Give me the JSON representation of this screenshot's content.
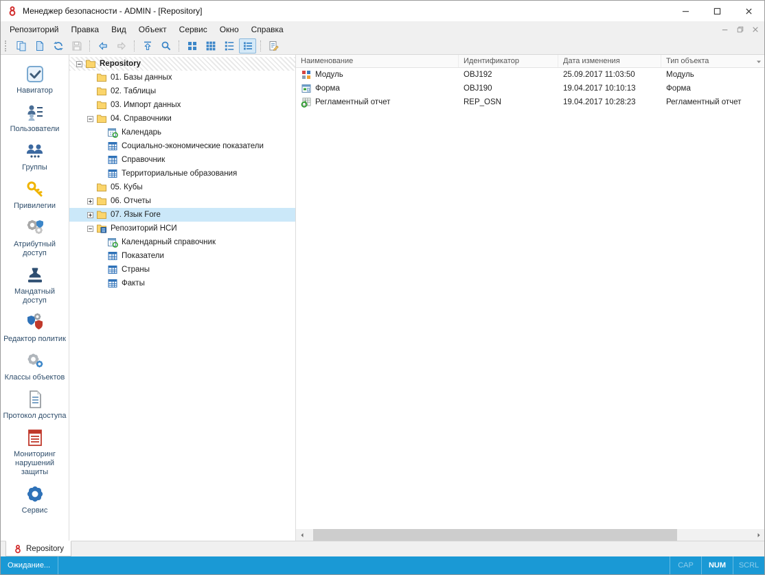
{
  "colors": {
    "statusbar_background": "#1a99d5",
    "tree_selection_background": "#cbe8f9",
    "toolbar_selected_background": "#d5e9f7",
    "accent_blue": "#2f72b8"
  },
  "window": {
    "title": "Менеджер безопасности - ADMIN - [Repository]",
    "app_icon": "app-logo-icon",
    "controls": [
      {
        "name": "minimize-button",
        "icon": "minimize-icon"
      },
      {
        "name": "maximize-button",
        "icon": "maximize-icon"
      },
      {
        "name": "close-button",
        "icon": "close-icon"
      }
    ]
  },
  "menubar": {
    "items": [
      {
        "name": "menu-repository",
        "label": "Репозиторий"
      },
      {
        "name": "menu-edit",
        "label": "Правка"
      },
      {
        "name": "menu-view",
        "label": "Вид"
      },
      {
        "name": "menu-object",
        "label": "Объект"
      },
      {
        "name": "menu-service",
        "label": "Сервис"
      },
      {
        "name": "menu-window",
        "label": "Окно"
      },
      {
        "name": "menu-help",
        "label": "Справка"
      }
    ],
    "mdi_controls": [
      {
        "name": "mdi-minimize-button",
        "icon": "mdi-minimize-icon"
      },
      {
        "name": "mdi-restore-button",
        "icon": "mdi-restore-icon"
      },
      {
        "name": "mdi-close-button",
        "icon": "mdi-close-icon"
      }
    ]
  },
  "toolbar": {
    "buttons": [
      {
        "name": "new-object-button",
        "icon": "new-page-icon"
      },
      {
        "name": "open-object-button",
        "icon": "page-icon"
      },
      {
        "name": "refresh-button",
        "icon": "refresh-icon"
      },
      {
        "name": "save-button",
        "icon": "save-icon",
        "disabled": true
      },
      {
        "separator": true
      },
      {
        "name": "back-button",
        "icon": "back-icon"
      },
      {
        "name": "forward-button",
        "icon": "forward-icon",
        "disabled": true
      },
      {
        "separator": true
      },
      {
        "name": "up-level-button",
        "icon": "up-level-icon"
      },
      {
        "name": "search-button",
        "icon": "search-icon"
      },
      {
        "separator": true
      },
      {
        "name": "view-large-icons-button",
        "icon": "view-large-icons-icon"
      },
      {
        "name": "view-small-icons-button",
        "icon": "view-small-icons-icon"
      },
      {
        "name": "view-list-button",
        "icon": "view-list-icon"
      },
      {
        "name": "view-details-button",
        "icon": "view-details-icon",
        "selected": true
      },
      {
        "separator": true
      },
      {
        "name": "properties-button",
        "icon": "properties-icon"
      }
    ]
  },
  "sidebar": {
    "items": [
      {
        "name": "sidebar-item-navigator",
        "label": "Навигатор",
        "icon": "navigator-icon",
        "selected": true
      },
      {
        "name": "sidebar-item-users",
        "label": "Пользователи",
        "icon": "users-icon"
      },
      {
        "name": "sidebar-item-groups",
        "label": "Группы",
        "icon": "groups-icon"
      },
      {
        "name": "sidebar-item-privileges",
        "label": "Привилегии",
        "icon": "key-icon"
      },
      {
        "name": "sidebar-item-attribute-access",
        "label": "Атрибутный доступ",
        "icon": "attribute-access-icon"
      },
      {
        "name": "sidebar-item-mandatory-access",
        "label": "Мандатный доступ",
        "icon": "stamp-icon"
      },
      {
        "name": "sidebar-item-policy-editor",
        "label": "Редактор политик",
        "icon": "policy-editor-icon"
      },
      {
        "name": "sidebar-item-object-classes",
        "label": "Классы объектов",
        "icon": "object-classes-icon"
      },
      {
        "name": "sidebar-item-access-log",
        "label": "Протокол доступа",
        "icon": "access-protocol-icon"
      },
      {
        "name": "sidebar-item-violation-monitoring",
        "label": "Мониторинг нарушений защиты",
        "icon": "monitoring-icon"
      },
      {
        "name": "sidebar-item-service",
        "label": "Сервис",
        "icon": "service-gear-icon"
      }
    ]
  },
  "tree": {
    "nodes": [
      {
        "label": "Repository",
        "icon": "folder-icon",
        "level": 0,
        "expander": "minus",
        "bold": true,
        "hatched": true
      },
      {
        "label": "01. Базы данных",
        "icon": "folder-icon",
        "level": 1
      },
      {
        "label": "02. Таблицы",
        "icon": "folder-icon",
        "level": 1
      },
      {
        "label": "03. Импорт данных",
        "icon": "folder-icon",
        "level": 1
      },
      {
        "label": "04. Справочники",
        "icon": "folder-icon",
        "level": 1,
        "expander": "minus"
      },
      {
        "label": "Календарь",
        "icon": "calendar-icon",
        "level": 2
      },
      {
        "label": "Социально-экономические показатели",
        "icon": "dictionary-icon",
        "level": 2
      },
      {
        "label": "Справочник",
        "icon": "dictionary-icon",
        "level": 2
      },
      {
        "label": "Территориальные образования",
        "icon": "dictionary-icon",
        "level": 2
      },
      {
        "label": "05. Кубы",
        "icon": "folder-icon",
        "level": 1
      },
      {
        "label": "06. Отчеты",
        "icon": "folder-icon",
        "level": 1,
        "expander": "plus"
      },
      {
        "label": "07. Язык Fore",
        "icon": "folder-icon",
        "level": 1,
        "expander": "plus",
        "selected": true
      },
      {
        "label": "Репозиторий НСИ",
        "icon": "nsi-repository-icon",
        "level": 1,
        "expander": "minus"
      },
      {
        "label": "Календарный справочник",
        "icon": "calendar-icon",
        "level": 2
      },
      {
        "label": "Показатели",
        "icon": "dictionary-icon",
        "level": 2
      },
      {
        "label": "Страны",
        "icon": "dictionary-icon",
        "level": 2
      },
      {
        "label": "Факты",
        "icon": "dictionary-icon",
        "level": 2
      }
    ]
  },
  "table": {
    "columns": [
      {
        "label": "Наименование"
      },
      {
        "label": "Идентификатор"
      },
      {
        "label": "Дата изменения"
      },
      {
        "label": "Тип объекта"
      }
    ],
    "rows": [
      {
        "icon": "module-icon",
        "cells": [
          "Модуль",
          "OBJ192",
          "25.09.2017 11:03:50",
          "Модуль"
        ]
      },
      {
        "icon": "form-icon",
        "cells": [
          "Форма",
          "OBJ190",
          "19.04.2017 10:10:13",
          "Форма"
        ]
      },
      {
        "icon": "report-icon",
        "cells": [
          "Регламентный отчет",
          "REP_OSN",
          "19.04.2017 10:28:23",
          "Регламентный отчет"
        ]
      }
    ]
  },
  "tabs": {
    "items": [
      {
        "name": "tab-repository",
        "label": "Repository",
        "icon": "app-logo-icon",
        "active": true
      }
    ]
  },
  "statusbar": {
    "text": "Ожидание...",
    "indicators": [
      {
        "label": "CAP",
        "active": false
      },
      {
        "label": "NUM",
        "active": true
      },
      {
        "label": "SCRL",
        "active": false
      }
    ]
  }
}
